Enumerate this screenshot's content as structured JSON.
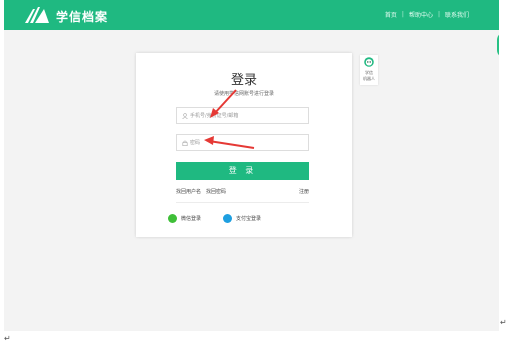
{
  "header": {
    "logo_text": "学信档案",
    "nav": [
      "首页",
      "帮助中心",
      "联系我们"
    ],
    "separator": "|"
  },
  "login": {
    "title": "登录",
    "subtitle": "请使用学信网账号进行登录",
    "username_placeholder": "手机号/身份证号/邮箱",
    "password_placeholder": "密码",
    "login_button": "登 录",
    "find_username": "找回用户名",
    "find_password": "找回密码",
    "register": "注册",
    "wechat_login": "微信登录",
    "alipay_login": "支付宝登录"
  },
  "robot": {
    "label_line1": "学信",
    "label_line2": "机器人"
  },
  "document": {
    "paragraph_mark": "↵",
    "paragraph_mark_2": "↵"
  },
  "colors": {
    "brand_green": "#1fb981",
    "annotation_red": "#e53935",
    "wechat_green": "#3fbf38",
    "alipay_blue": "#1e9fe0"
  },
  "icons": [
    "logo-mark-icon",
    "user-icon",
    "lock-icon",
    "wechat-icon",
    "alipay-icon",
    "robot-icon",
    "annotation-arrow-icon"
  ]
}
